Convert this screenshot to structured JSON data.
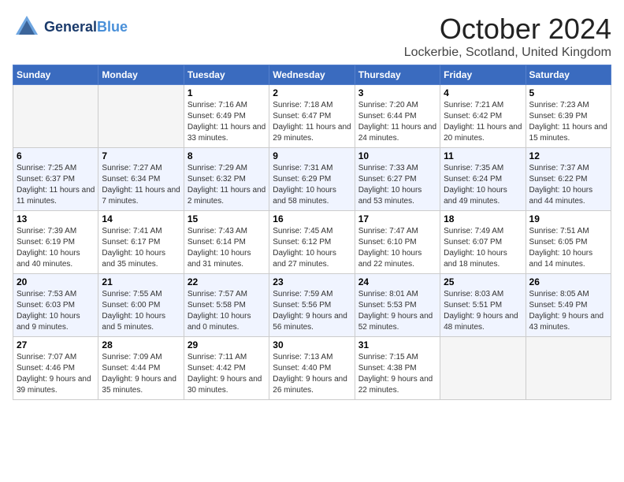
{
  "header": {
    "logo_general": "General",
    "logo_blue": "Blue",
    "month_title": "October 2024",
    "location": "Lockerbie, Scotland, United Kingdom"
  },
  "days_of_week": [
    "Sunday",
    "Monday",
    "Tuesday",
    "Wednesday",
    "Thursday",
    "Friday",
    "Saturday"
  ],
  "weeks": [
    [
      {
        "day": "",
        "info": ""
      },
      {
        "day": "",
        "info": ""
      },
      {
        "day": "1",
        "sunrise": "Sunrise: 7:16 AM",
        "sunset": "Sunset: 6:49 PM",
        "daylight": "Daylight: 11 hours and 33 minutes."
      },
      {
        "day": "2",
        "sunrise": "Sunrise: 7:18 AM",
        "sunset": "Sunset: 6:47 PM",
        "daylight": "Daylight: 11 hours and 29 minutes."
      },
      {
        "day": "3",
        "sunrise": "Sunrise: 7:20 AM",
        "sunset": "Sunset: 6:44 PM",
        "daylight": "Daylight: 11 hours and 24 minutes."
      },
      {
        "day": "4",
        "sunrise": "Sunrise: 7:21 AM",
        "sunset": "Sunset: 6:42 PM",
        "daylight": "Daylight: 11 hours and 20 minutes."
      },
      {
        "day": "5",
        "sunrise": "Sunrise: 7:23 AM",
        "sunset": "Sunset: 6:39 PM",
        "daylight": "Daylight: 11 hours and 15 minutes."
      }
    ],
    [
      {
        "day": "6",
        "sunrise": "Sunrise: 7:25 AM",
        "sunset": "Sunset: 6:37 PM",
        "daylight": "Daylight: 11 hours and 11 minutes."
      },
      {
        "day": "7",
        "sunrise": "Sunrise: 7:27 AM",
        "sunset": "Sunset: 6:34 PM",
        "daylight": "Daylight: 11 hours and 7 minutes."
      },
      {
        "day": "8",
        "sunrise": "Sunrise: 7:29 AM",
        "sunset": "Sunset: 6:32 PM",
        "daylight": "Daylight: 11 hours and 2 minutes."
      },
      {
        "day": "9",
        "sunrise": "Sunrise: 7:31 AM",
        "sunset": "Sunset: 6:29 PM",
        "daylight": "Daylight: 10 hours and 58 minutes."
      },
      {
        "day": "10",
        "sunrise": "Sunrise: 7:33 AM",
        "sunset": "Sunset: 6:27 PM",
        "daylight": "Daylight: 10 hours and 53 minutes."
      },
      {
        "day": "11",
        "sunrise": "Sunrise: 7:35 AM",
        "sunset": "Sunset: 6:24 PM",
        "daylight": "Daylight: 10 hours and 49 minutes."
      },
      {
        "day": "12",
        "sunrise": "Sunrise: 7:37 AM",
        "sunset": "Sunset: 6:22 PM",
        "daylight": "Daylight: 10 hours and 44 minutes."
      }
    ],
    [
      {
        "day": "13",
        "sunrise": "Sunrise: 7:39 AM",
        "sunset": "Sunset: 6:19 PM",
        "daylight": "Daylight: 10 hours and 40 minutes."
      },
      {
        "day": "14",
        "sunrise": "Sunrise: 7:41 AM",
        "sunset": "Sunset: 6:17 PM",
        "daylight": "Daylight: 10 hours and 35 minutes."
      },
      {
        "day": "15",
        "sunrise": "Sunrise: 7:43 AM",
        "sunset": "Sunset: 6:14 PM",
        "daylight": "Daylight: 10 hours and 31 minutes."
      },
      {
        "day": "16",
        "sunrise": "Sunrise: 7:45 AM",
        "sunset": "Sunset: 6:12 PM",
        "daylight": "Daylight: 10 hours and 27 minutes."
      },
      {
        "day": "17",
        "sunrise": "Sunrise: 7:47 AM",
        "sunset": "Sunset: 6:10 PM",
        "daylight": "Daylight: 10 hours and 22 minutes."
      },
      {
        "day": "18",
        "sunrise": "Sunrise: 7:49 AM",
        "sunset": "Sunset: 6:07 PM",
        "daylight": "Daylight: 10 hours and 18 minutes."
      },
      {
        "day": "19",
        "sunrise": "Sunrise: 7:51 AM",
        "sunset": "Sunset: 6:05 PM",
        "daylight": "Daylight: 10 hours and 14 minutes."
      }
    ],
    [
      {
        "day": "20",
        "sunrise": "Sunrise: 7:53 AM",
        "sunset": "Sunset: 6:03 PM",
        "daylight": "Daylight: 10 hours and 9 minutes."
      },
      {
        "day": "21",
        "sunrise": "Sunrise: 7:55 AM",
        "sunset": "Sunset: 6:00 PM",
        "daylight": "Daylight: 10 hours and 5 minutes."
      },
      {
        "day": "22",
        "sunrise": "Sunrise: 7:57 AM",
        "sunset": "Sunset: 5:58 PM",
        "daylight": "Daylight: 10 hours and 0 minutes."
      },
      {
        "day": "23",
        "sunrise": "Sunrise: 7:59 AM",
        "sunset": "Sunset: 5:56 PM",
        "daylight": "Daylight: 9 hours and 56 minutes."
      },
      {
        "day": "24",
        "sunrise": "Sunrise: 8:01 AM",
        "sunset": "Sunset: 5:53 PM",
        "daylight": "Daylight: 9 hours and 52 minutes."
      },
      {
        "day": "25",
        "sunrise": "Sunrise: 8:03 AM",
        "sunset": "Sunset: 5:51 PM",
        "daylight": "Daylight: 9 hours and 48 minutes."
      },
      {
        "day": "26",
        "sunrise": "Sunrise: 8:05 AM",
        "sunset": "Sunset: 5:49 PM",
        "daylight": "Daylight: 9 hours and 43 minutes."
      }
    ],
    [
      {
        "day": "27",
        "sunrise": "Sunrise: 7:07 AM",
        "sunset": "Sunset: 4:46 PM",
        "daylight": "Daylight: 9 hours and 39 minutes."
      },
      {
        "day": "28",
        "sunrise": "Sunrise: 7:09 AM",
        "sunset": "Sunset: 4:44 PM",
        "daylight": "Daylight: 9 hours and 35 minutes."
      },
      {
        "day": "29",
        "sunrise": "Sunrise: 7:11 AM",
        "sunset": "Sunset: 4:42 PM",
        "daylight": "Daylight: 9 hours and 30 minutes."
      },
      {
        "day": "30",
        "sunrise": "Sunrise: 7:13 AM",
        "sunset": "Sunset: 4:40 PM",
        "daylight": "Daylight: 9 hours and 26 minutes."
      },
      {
        "day": "31",
        "sunrise": "Sunrise: 7:15 AM",
        "sunset": "Sunset: 4:38 PM",
        "daylight": "Daylight: 9 hours and 22 minutes."
      },
      {
        "day": "",
        "info": ""
      },
      {
        "day": "",
        "info": ""
      }
    ]
  ]
}
